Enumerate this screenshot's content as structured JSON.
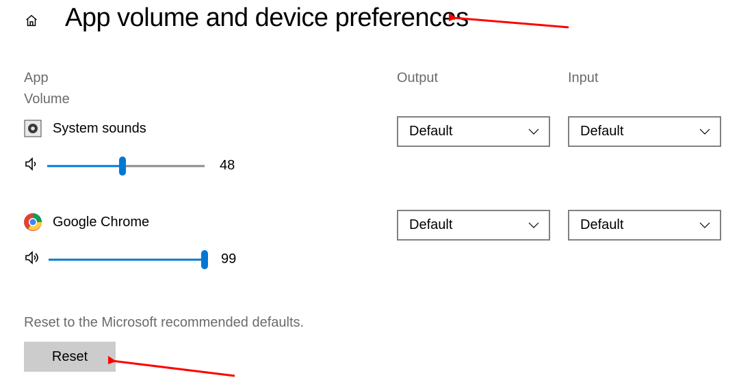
{
  "header": {
    "page_title": "App volume and device preferences"
  },
  "columns": {
    "app": "App",
    "output": "Output",
    "input": "Input",
    "volume": "Volume"
  },
  "apps": [
    {
      "name": "System sounds",
      "volume": 48,
      "output": "Default",
      "input": "Default",
      "icon": "system-sounds"
    },
    {
      "name": "Google Chrome",
      "volume": 99,
      "output": "Default",
      "input": "Default",
      "icon": "chrome"
    }
  ],
  "reset": {
    "description": "Reset to the Microsoft recommended defaults.",
    "button_label": "Reset"
  }
}
